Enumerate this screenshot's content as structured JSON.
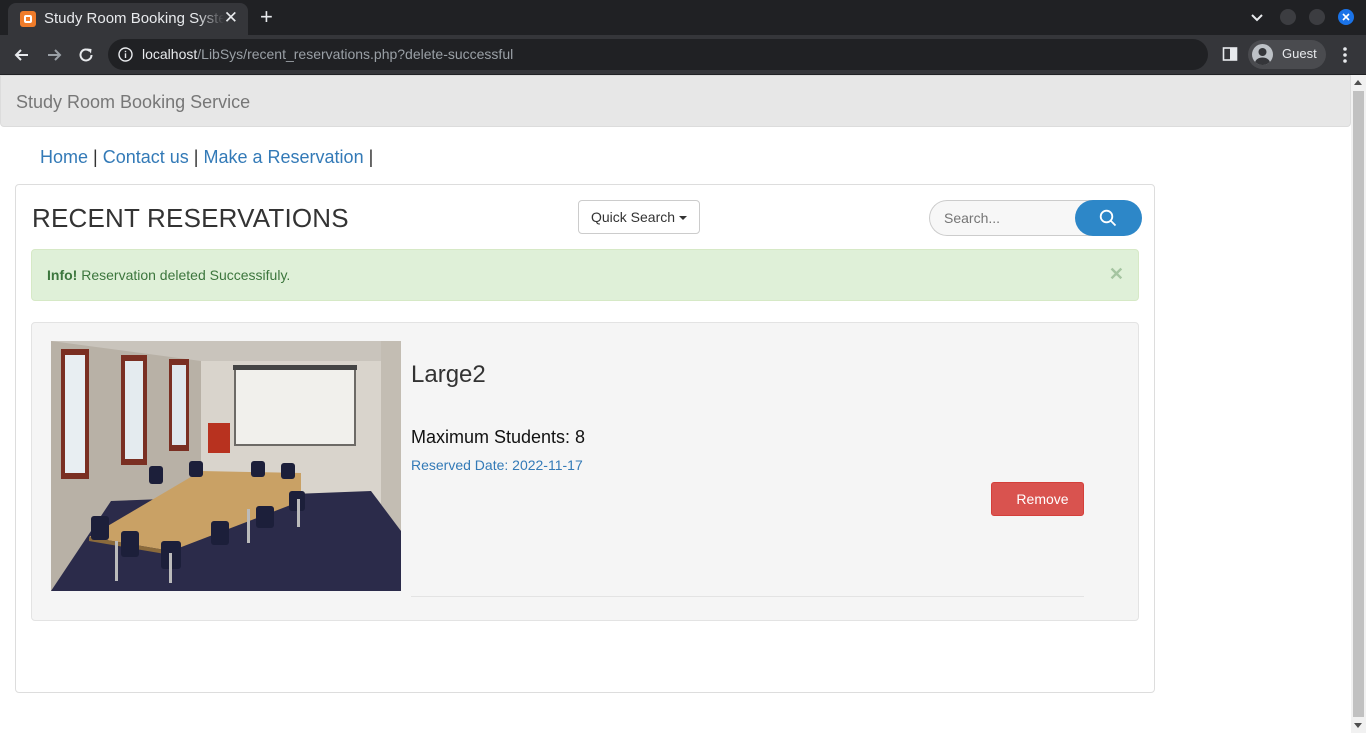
{
  "browser": {
    "tab_title": "Study Room Booking System",
    "url_host": "localhost",
    "url_path": "/LibSys/recent_reservations.php?delete-successful",
    "profile_label": "Guest"
  },
  "navbar": {
    "brand": "Study Room Booking Service"
  },
  "links": {
    "home": "Home",
    "contact": "Contact us",
    "reserve": "Make a Reservation",
    "separator": "|"
  },
  "main": {
    "heading": "RECENT RESERVATIONS",
    "quick_search_label": "Quick Search",
    "search_placeholder": "Search..."
  },
  "alert": {
    "prefix": "Info!",
    "message": "Reservation deleted Successifuly."
  },
  "reservation": {
    "room_name": "Large2",
    "capacity_text": "Maximum Students: 8",
    "date_text": "Reserved Date: 2022-11-17",
    "remove_label": "Remove"
  },
  "colors": {
    "alert_bg": "#dff0d8",
    "link": "#337ab7",
    "danger": "#d9534f",
    "search_button": "#2d87c8"
  },
  "icons": {
    "favicon": "xampp-favicon",
    "close": "close-icon",
    "search": "search-icon",
    "back": "back-arrow-icon",
    "forward": "forward-arrow-icon",
    "reload": "reload-icon"
  }
}
